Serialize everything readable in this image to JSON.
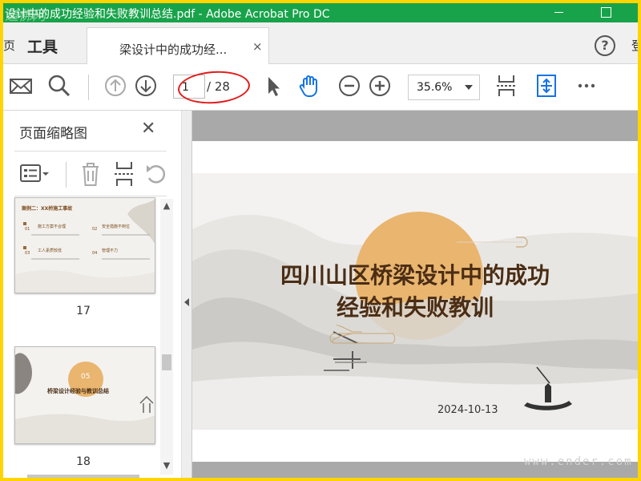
{
  "window": {
    "title": "设计中的成功经验和失败教训总结.pdf - Adobe Acrobat Pro DC",
    "watermark": "道佛网",
    "accent_color": "#18a34a"
  },
  "tabs": {
    "tools_label": "工具",
    "document_label": "梁设计中的成功经...",
    "close_glyph": "×",
    "help_glyph": "?",
    "left_edge_glyph": "页",
    "right_edge_glyph": "登"
  },
  "toolbar": {
    "icons": [
      "mail-icon",
      "search-icon",
      "prev-page-icon",
      "next-page-icon",
      "select-arrow-icon",
      "hand-icon",
      "zoom-out-icon",
      "zoom-in-icon",
      "fit-page-icon",
      "scroll-mode-icon",
      "more-icon"
    ],
    "current_page": "1",
    "total_pages": "/ 28",
    "zoom": "35.6%"
  },
  "thumbnails": {
    "title": "页面缩略图",
    "close_glyph": "✕",
    "pages": [
      {
        "number": "17",
        "heading": "案例二：XX桥施工事故",
        "items": [
          "施工方案不合理",
          "安全措施不到位",
          "工人素质较低",
          "管理不力"
        ],
        "item_numbers": [
          "01",
          "02",
          "03",
          "04"
        ]
      },
      {
        "number": "18",
        "badge": "05",
        "heading": "桥梁设计经验与教训总结"
      }
    ]
  },
  "document": {
    "title_line1": "四川山区桥梁设计中的成功",
    "title_line2": "经验和失败教训",
    "date": "2024-10-13",
    "sun_color": "#e9b56f"
  },
  "footer_watermark": "www.ender.com"
}
